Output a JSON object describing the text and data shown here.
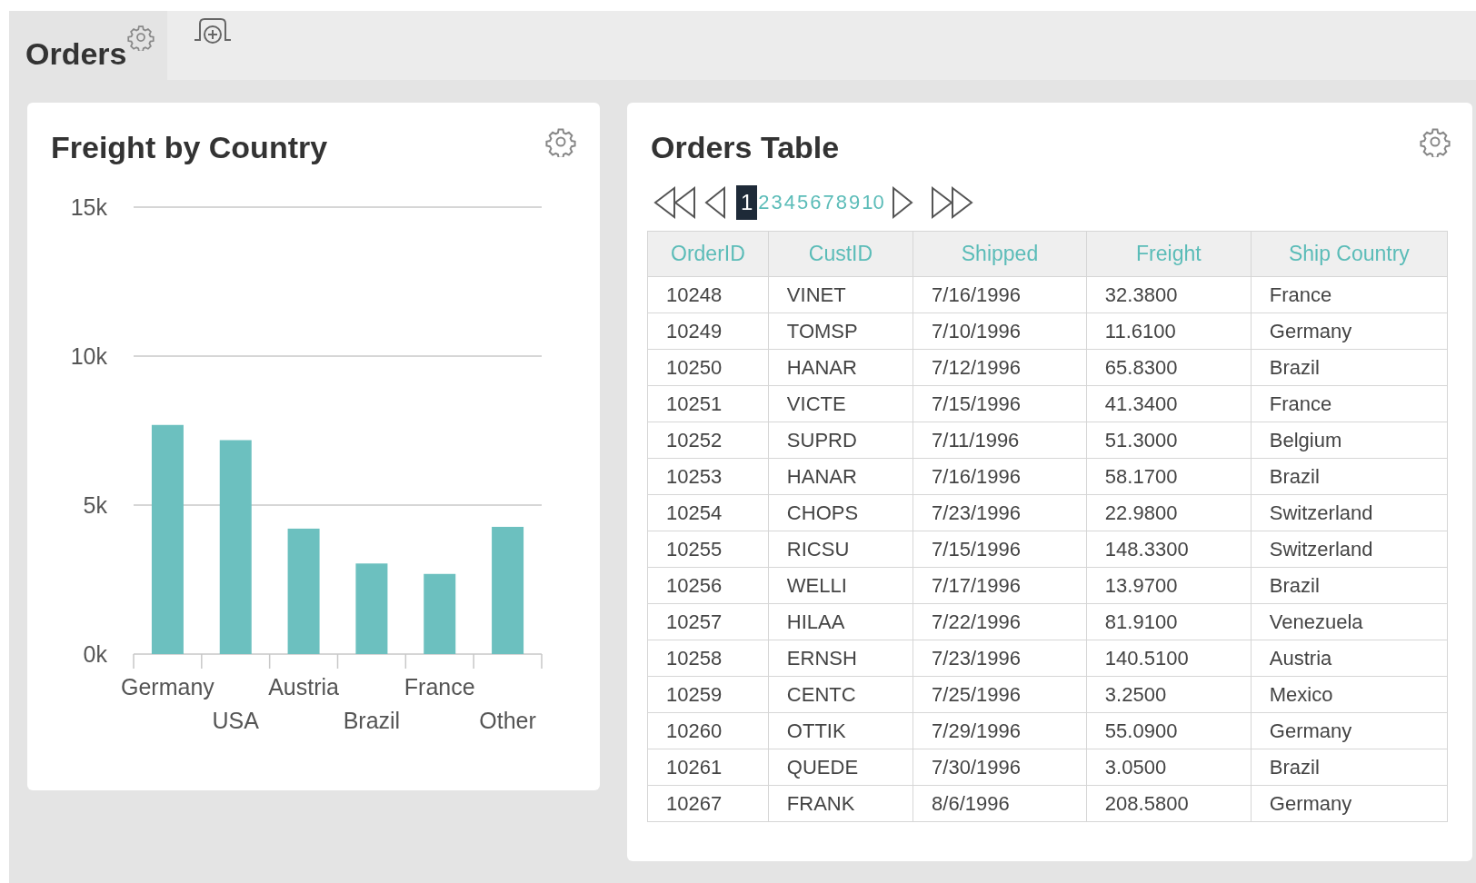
{
  "tabs": [
    {
      "label": "Orders",
      "selected": true
    }
  ],
  "chart_panel": {
    "title": "Freight by Country",
    "chart_data": {
      "type": "bar",
      "categories": [
        "Germany",
        "USA",
        "Austria",
        "Brazil",
        "France",
        "Other"
      ],
      "series": [
        {
          "color": "#6cc0bf",
          "values": [
            7690,
            7180,
            4210,
            3040,
            2690,
            4270
          ]
        }
      ],
      "ylim": [
        0,
        15000
      ],
      "yticks": [
        {
          "value": 0,
          "label": "0k"
        },
        {
          "value": 5000,
          "label": "5k"
        },
        {
          "value": 10000,
          "label": "10k"
        },
        {
          "value": 15000,
          "label": "15k"
        }
      ]
    }
  },
  "table_panel": {
    "title": "Orders Table",
    "pages": [
      {
        "label": "1",
        "selected": true
      },
      {
        "label": "2",
        "selected": false
      },
      {
        "label": "3",
        "selected": false
      },
      {
        "label": "4",
        "selected": false
      },
      {
        "label": "5",
        "selected": false
      },
      {
        "label": "6",
        "selected": false
      },
      {
        "label": "7",
        "selected": false
      },
      {
        "label": "8",
        "selected": false
      },
      {
        "label": "9",
        "selected": false
      },
      {
        "label": "10",
        "selected": false
      }
    ],
    "columns": [
      "OrderID",
      "CustID",
      "Shipped",
      "Freight",
      "Ship Country"
    ],
    "rows": [
      [
        "10248",
        "VINET",
        "7/16/1996",
        "32.3800",
        "France"
      ],
      [
        "10249",
        "TOMSP",
        "7/10/1996",
        "11.6100",
        "Germany"
      ],
      [
        "10250",
        "HANAR",
        "7/12/1996",
        "65.8300",
        "Brazil"
      ],
      [
        "10251",
        "VICTE",
        "7/15/1996",
        "41.3400",
        "France"
      ],
      [
        "10252",
        "SUPRD",
        "7/11/1996",
        "51.3000",
        "Belgium"
      ],
      [
        "10253",
        "HANAR",
        "7/16/1996",
        "58.1700",
        "Brazil"
      ],
      [
        "10254",
        "CHOPS",
        "7/23/1996",
        "22.9800",
        "Switzerland"
      ],
      [
        "10255",
        "RICSU",
        "7/15/1996",
        "148.3300",
        "Switzerland"
      ],
      [
        "10256",
        "WELLI",
        "7/17/1996",
        "13.9700",
        "Brazil"
      ],
      [
        "10257",
        "HILAA",
        "7/22/1996",
        "81.9100",
        "Venezuela"
      ],
      [
        "10258",
        "ERNSH",
        "7/23/1996",
        "140.5100",
        "Austria"
      ],
      [
        "10259",
        "CENTC",
        "7/25/1996",
        "3.2500",
        "Mexico"
      ],
      [
        "10260",
        "OTTIK",
        "7/29/1996",
        "55.0900",
        "Germany"
      ],
      [
        "10261",
        "QUEDE",
        "7/30/1996",
        "3.0500",
        "Brazil"
      ],
      [
        "10267",
        "FRANK",
        "8/6/1996",
        "208.5800",
        "Germany"
      ]
    ]
  }
}
